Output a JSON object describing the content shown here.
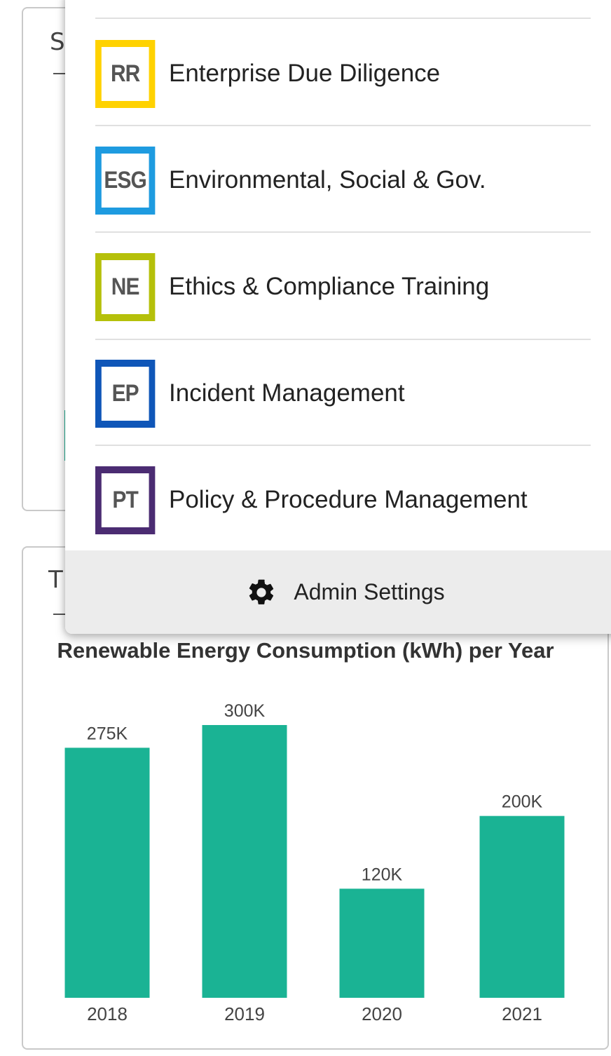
{
  "background_cards": {
    "top": {
      "title_fragment": "S"
    },
    "bottom": {
      "title_fragment": "T"
    }
  },
  "menu": {
    "items": [
      {
        "badge": "RR",
        "label": "Enterprise Due Diligence",
        "color": "#ffd200"
      },
      {
        "badge": "ESG",
        "label": "Environmental, Social & Gov.",
        "color": "#1e9be0"
      },
      {
        "badge": "NE",
        "label": "Ethics & Compliance Training",
        "color": "#b5c00a"
      },
      {
        "badge": "EP",
        "label": "Incident Management",
        "color": "#0f56b8"
      },
      {
        "badge": "PT",
        "label": "Policy & Procedure Management",
        "color": "#4b2c72"
      }
    ],
    "admin": {
      "label": "Admin Settings",
      "icon": "gear-icon"
    }
  },
  "chart_data": {
    "type": "bar",
    "title": "Renewable Energy Consumption (kWh) per Year",
    "categories": [
      "2018",
      "2019",
      "2020",
      "2021"
    ],
    "values": [
      275000,
      300000,
      120000,
      200000
    ],
    "value_labels": [
      "275K",
      "300K",
      "120K",
      "200K"
    ],
    "ylim": [
      0,
      300000
    ],
    "bar_color": "#1ab394",
    "grid": false
  }
}
